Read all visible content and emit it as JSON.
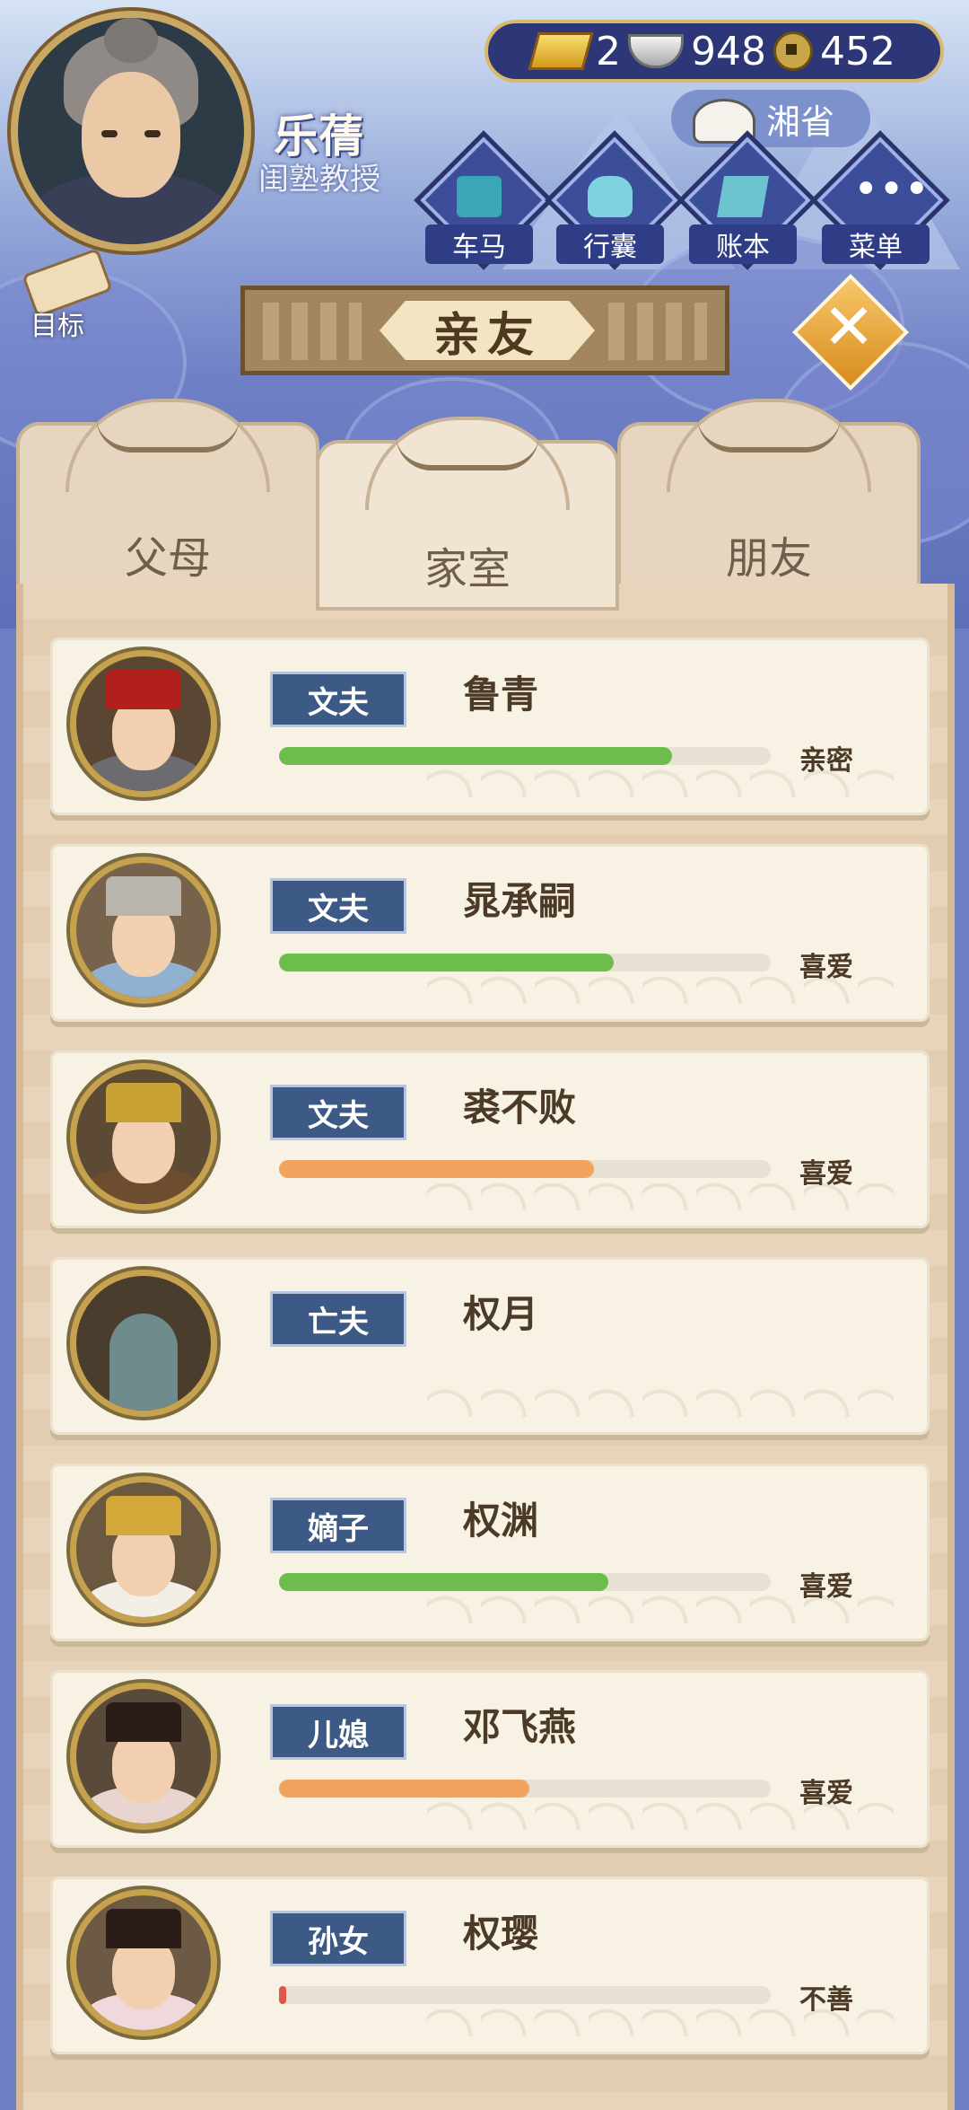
{
  "player": {
    "name": "乐蒨",
    "title": "闺塾教授"
  },
  "currency": {
    "gold": "2",
    "silver": "948",
    "coins": "452"
  },
  "location": "湘省",
  "menu": [
    {
      "label": "车马",
      "icon": "carriage-icon"
    },
    {
      "label": "行囊",
      "icon": "bag-icon"
    },
    {
      "label": "账本",
      "icon": "ledger-icon"
    },
    {
      "label": "菜单",
      "icon": "more-icon"
    }
  ],
  "goal": "目标",
  "section_title": "亲友",
  "tabs": [
    {
      "label": "父母",
      "active": false
    },
    {
      "label": "家室",
      "active": true
    },
    {
      "label": "朋友",
      "active": false
    }
  ],
  "relatives": [
    {
      "role": "文夫",
      "name": "鲁青",
      "relation": "亲密",
      "affinity": 0.8,
      "bar_color": "#6cbd4c"
    },
    {
      "role": "文夫",
      "name": "晁承嗣",
      "relation": "喜爱",
      "affinity": 0.68,
      "bar_color": "#6cbd4c"
    },
    {
      "role": "文夫",
      "name": "裘不败",
      "relation": "喜爱",
      "affinity": 0.64,
      "bar_color": "#f0a35e"
    },
    {
      "role": "亡夫",
      "name": "权月",
      "relation": "",
      "affinity": null,
      "bar_color": ""
    },
    {
      "role": "嫡子",
      "name": "权渊",
      "relation": "喜爱",
      "affinity": 0.67,
      "bar_color": "#6cbd4c"
    },
    {
      "role": "儿媳",
      "name": "邓飞燕",
      "relation": "喜爱",
      "affinity": 0.51,
      "bar_color": "#f0a35e"
    },
    {
      "role": "孙女",
      "name": "权璎",
      "relation": "不善",
      "affinity": 0.01,
      "bar_color": "#e0574a"
    }
  ]
}
